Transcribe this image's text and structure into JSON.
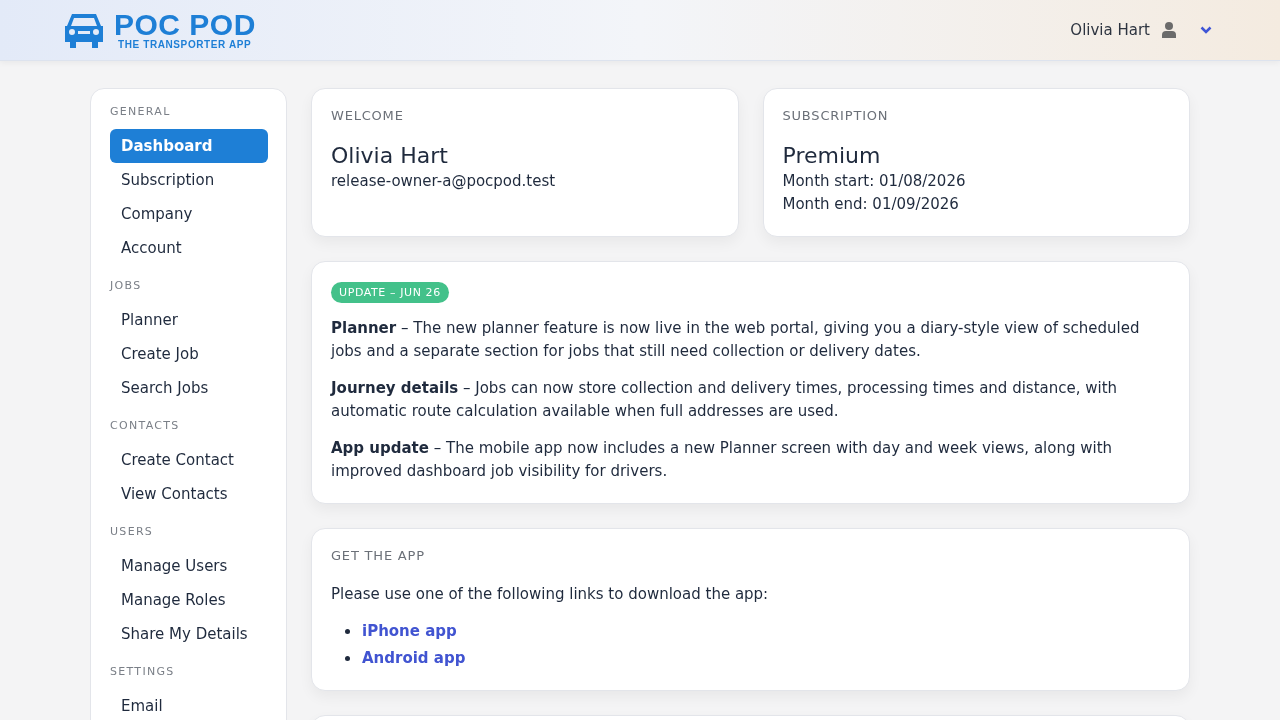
{
  "header": {
    "logo_title": "POC POD",
    "logo_subtitle": "THE TRANSPORTER APP",
    "user_name": "Olivia Hart"
  },
  "sidebar": {
    "sections": [
      {
        "heading": "GENERAL",
        "items": [
          {
            "label": "Dashboard",
            "selected": true
          },
          {
            "label": "Subscription",
            "selected": false
          },
          {
            "label": "Company",
            "selected": false
          },
          {
            "label": "Account",
            "selected": false
          }
        ]
      },
      {
        "heading": "JOBS",
        "items": [
          {
            "label": "Planner",
            "selected": false
          },
          {
            "label": "Create Job",
            "selected": false
          },
          {
            "label": "Search Jobs",
            "selected": false
          }
        ]
      },
      {
        "heading": "CONTACTS",
        "items": [
          {
            "label": "Create Contact",
            "selected": false
          },
          {
            "label": "View Contacts",
            "selected": false
          }
        ]
      },
      {
        "heading": "USERS",
        "items": [
          {
            "label": "Manage Users",
            "selected": false
          },
          {
            "label": "Manage Roles",
            "selected": false
          },
          {
            "label": "Share My Details",
            "selected": false
          }
        ]
      },
      {
        "heading": "SETTINGS",
        "items": [
          {
            "label": "Email",
            "selected": false
          }
        ]
      }
    ]
  },
  "welcome": {
    "heading": "WELCOME",
    "name": "Olivia Hart",
    "email": "release-owner-a@pocpod.test"
  },
  "subscription": {
    "heading": "SUBSCRIPTION",
    "plan": "Premium",
    "lines": [
      "Month start: 01/08/2026",
      "Month end: 01/09/2026"
    ]
  },
  "update": {
    "badge": "UPDATE – JUN 26",
    "paragraphs": [
      "**Planner** – The new planner feature is now live in the web portal, giving you a diary-style view of scheduled jobs and a separate section for jobs that still need collection or delivery dates.",
      "**Journey details** – Jobs can now store collection and delivery times, processing times and distance, with automatic route calculation available when full addresses are used.",
      "**App update** – The mobile app now includes a new Planner screen with day and week views, along with improved dashboard job visibility for drivers."
    ]
  },
  "get_app": {
    "heading": "GET THE APP",
    "intro": "Please use one of the following links to download the app:",
    "links": [
      "iPhone app",
      "Android app"
    ]
  }
}
